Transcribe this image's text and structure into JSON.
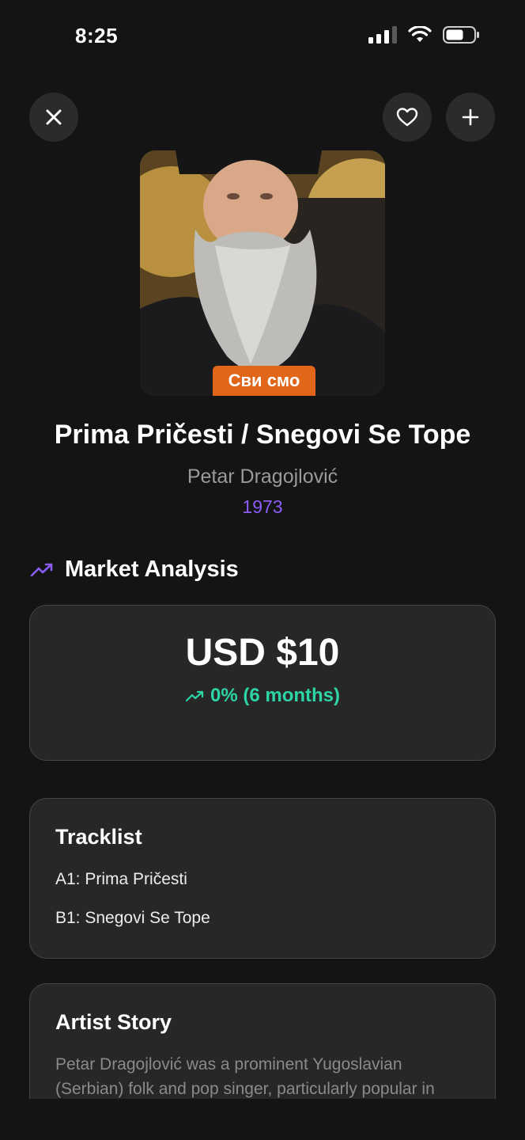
{
  "status_bar": {
    "time": "8:25"
  },
  "header": {
    "close_icon": "close-icon",
    "favorite_icon": "heart-icon",
    "add_icon": "plus-icon"
  },
  "cover": {
    "caption": "Сви смо"
  },
  "release": {
    "title": "Prima Pričesti / Snegovi Se Tope",
    "artist": "Petar Dragojlović",
    "year": "1973"
  },
  "market": {
    "heading": "Market Analysis",
    "price": "USD $10",
    "change": "0% (6 months)"
  },
  "tracklist": {
    "heading": "Tracklist",
    "items": [
      {
        "label": "A1: Prima Pričesti"
      },
      {
        "label": "B1: Snegovi Se Tope"
      }
    ]
  },
  "artist_story": {
    "heading": "Artist Story",
    "text": "Petar Dragojlović was a prominent Yugoslavian (Serbian) folk and pop singer, particularly popular in"
  },
  "colors": {
    "accent": "#8b5cf6",
    "positive": "#2dd4a6",
    "background": "#141414",
    "card": "#272727"
  }
}
